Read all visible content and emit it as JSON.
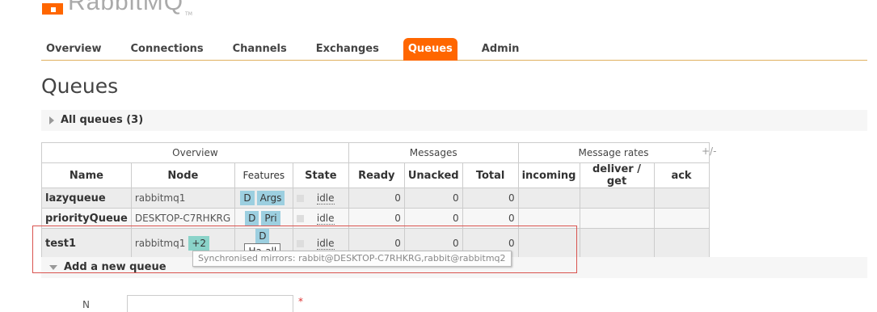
{
  "app": {
    "logo_text": "RabbitMQ",
    "logo_tm": "TM",
    "accent": "#ff6600"
  },
  "nav": {
    "tabs": [
      {
        "label": "Overview",
        "active": false
      },
      {
        "label": "Connections",
        "active": false
      },
      {
        "label": "Channels",
        "active": false
      },
      {
        "label": "Exchanges",
        "active": false
      },
      {
        "label": "Queues",
        "active": true
      },
      {
        "label": "Admin",
        "active": false
      }
    ]
  },
  "page": {
    "title": "Queues"
  },
  "all_queues": {
    "label": "All queues (3)"
  },
  "table": {
    "groups": {
      "overview": "Overview",
      "messages": "Messages",
      "rates": "Message rates",
      "toggle": "+/-"
    },
    "columns": {
      "name": "Name",
      "node": "Node",
      "features": "Features",
      "state": "State",
      "ready": "Ready",
      "unacked": "Unacked",
      "total": "Total",
      "incoming": "incoming",
      "deliver_get": "deliver / get",
      "ack": "ack"
    },
    "rows": [
      {
        "name": "lazyqueue",
        "node": "rabbitmq1",
        "mirrors": "",
        "features": [
          "D",
          "Args"
        ],
        "state": "idle",
        "ready": "0",
        "unacked": "0",
        "total": "0"
      },
      {
        "name": "priorityQueue",
        "node": "DESKTOP-C7RHKRG",
        "mirrors": "",
        "features": [
          "D",
          "Pri"
        ],
        "state": "idle",
        "ready": "0",
        "unacked": "0",
        "total": "0"
      },
      {
        "name": "test1",
        "node": "rabbitmq1",
        "mirrors": "+2",
        "features": [
          "D",
          "Ha-all"
        ],
        "state": "idle",
        "ready": "0",
        "unacked": "0",
        "total": "0"
      }
    ]
  },
  "tooltip": {
    "text": "Synchronised mirrors: rabbit@DESKTOP-C7RHKRG,rabbit@rabbitmq2"
  },
  "add_queue": {
    "label": "Add a new queue",
    "field_label_partial": "N",
    "required_mark": "*"
  },
  "colors": {
    "feature_chip": "#9ccfe0",
    "mirror_chip": "#8ad3c9",
    "highlight": "#d9534f"
  }
}
